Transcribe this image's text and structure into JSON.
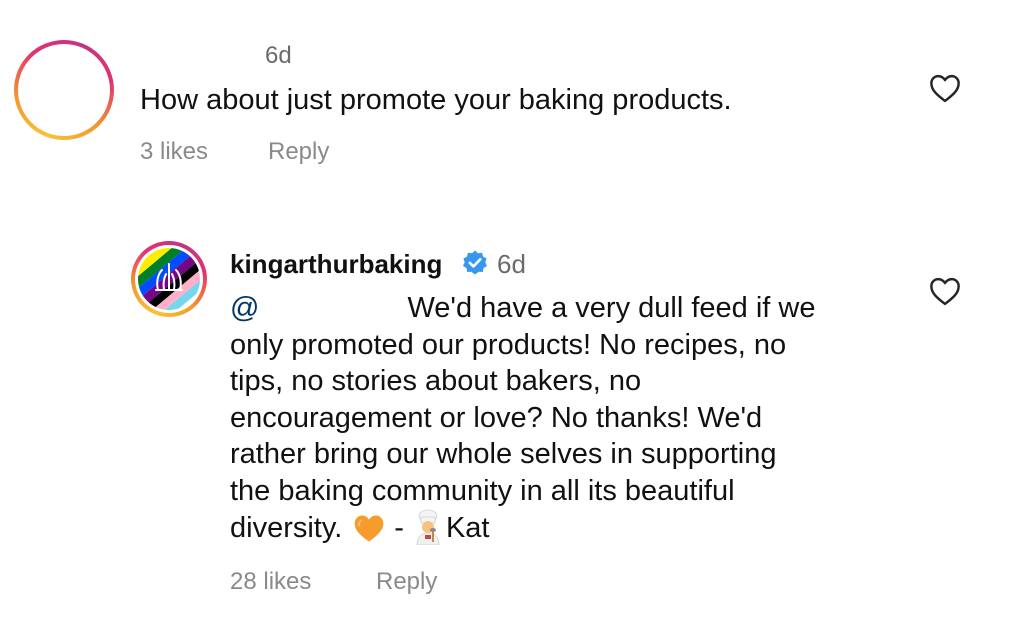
{
  "comments": [
    {
      "username": "",
      "time": "6d",
      "text": "How about just promote your baking products.",
      "likes": "3 likes",
      "reply_label": "Reply"
    },
    {
      "username": "kingarthurbaking",
      "verified": true,
      "time": "6d",
      "mention": "@",
      "text_lines": [
        "We'd have a very dull feed if we",
        "only promoted our products! No recipes, no",
        "tips, no stories about bakers, no",
        "encouragement or love? No thanks! We'd",
        "rather bring our whole selves in supporting",
        "the baking community in all its beautiful",
        "diversity."
      ],
      "signature_dash": "-",
      "signature_name": "Kat",
      "emojis": [
        "orange-heart",
        "cook"
      ],
      "likes": "28 likes",
      "reply_label": "Reply"
    }
  ],
  "colors": {
    "text": "#111111",
    "secondary": "#8a8a8a",
    "mention": "#00376b",
    "verified": "#3797f0",
    "story_ring_start": "#f8c436",
    "story_ring_end": "#c13584"
  },
  "icons": [
    "heart-outline-icon",
    "verified-badge-icon"
  ]
}
